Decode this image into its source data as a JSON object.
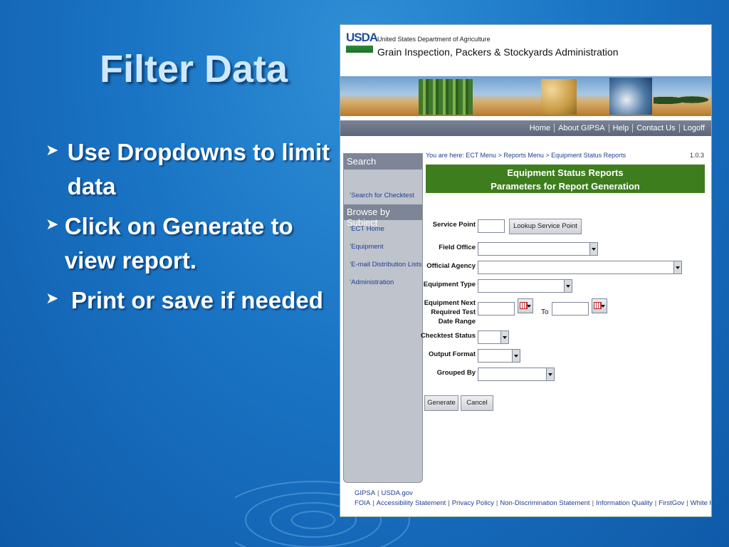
{
  "slide": {
    "title": "Filter Data",
    "bullets": [
      "Use Dropdowns to limit data",
      "Click on Generate to view report.",
      "Print or save if needed"
    ]
  },
  "site": {
    "logo_text": "USDA",
    "department": "United States Department of Agriculture",
    "agency": "Grain Inspection, Packers & Stockyards Administration"
  },
  "topnav": [
    "Home",
    "About GIPSA",
    "Help",
    "Contact Us",
    "Logoff"
  ],
  "sidebar": {
    "search_header": "Search",
    "search_items": [
      "Search for Checktest"
    ],
    "browse_header": "Browse by Subject",
    "browse_items": [
      "ECT Home",
      "Equipment",
      "E-mail Distribution Lists",
      "Administration"
    ]
  },
  "breadcrumb": "You are here: ECT Menu > Reports Menu > Equipment Status Reports",
  "version": "1.0.3",
  "report_title": {
    "line1": "Equipment Status Reports",
    "line2": "Parameters for Report Generation"
  },
  "form": {
    "service_point_label": "Service Point",
    "lookup_button": "Lookup Service Point",
    "field_office_label": "Field Office",
    "official_agency_label": "Official Agency",
    "equipment_type_label": "Equipment Type",
    "date_range_label_1": "Equipment Next",
    "date_range_label_2": "Required Test",
    "date_range_label_3": "Date Range",
    "to_label": "To",
    "checktest_status_label": "Checktest Status",
    "output_format_label": "Output Format",
    "grouped_by_label": "Grouped By",
    "generate_button": "Generate",
    "cancel_button": "Cancel"
  },
  "footer": {
    "line1": [
      "GIPSA",
      "USDA.gov"
    ],
    "line2": [
      "FOIA",
      "Accessibility Statement",
      "Privacy Policy",
      "Non-Discrimination Statement",
      "Information Quality",
      "FirstGov",
      "White House"
    ]
  }
}
